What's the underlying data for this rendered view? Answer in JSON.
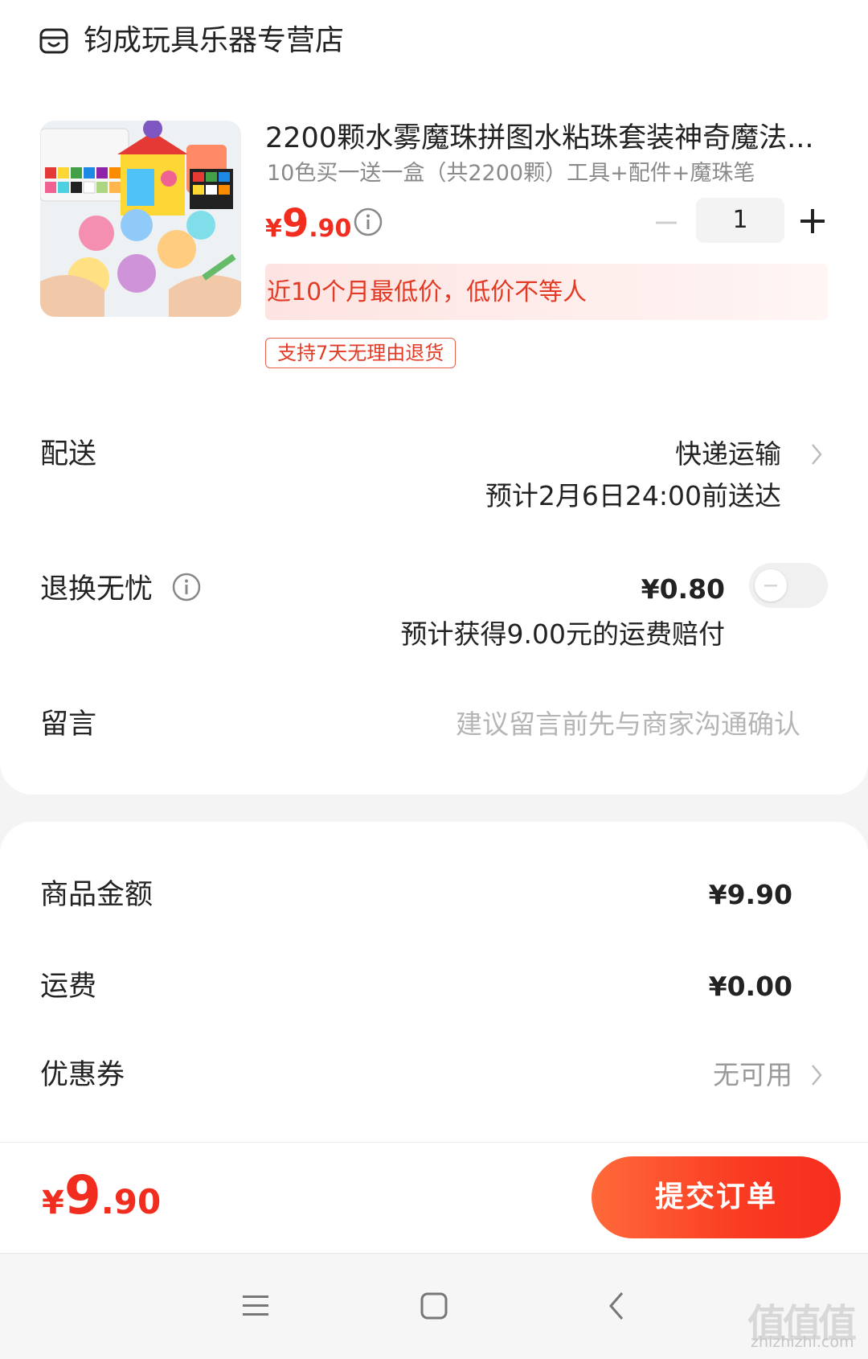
{
  "store": {
    "name": "钧成玩具乐器专营店",
    "icon": "store-icon"
  },
  "product": {
    "title": "2200颗水雾魔珠拼图水粘珠套装神奇魔法...",
    "spec": "10色买一送一盒（共2200颗）工具+配件+魔珠笔",
    "price_currency": "¥",
    "price_int": "9",
    "price_dec": ".90",
    "quantity": "1",
    "promo": "近10个月最低价，低价不等人",
    "return_badge": "支持7天无理由退货"
  },
  "delivery": {
    "label": "配送",
    "method": "快递运输",
    "estimate": "预计2月6日24:00前送达"
  },
  "return_insurance": {
    "label": "退换无忧",
    "price": "¥0.80",
    "note": "预计获得9.00元的运费赔付",
    "enabled": false
  },
  "message": {
    "label": "留言",
    "placeholder": "建议留言前先与商家沟通确认"
  },
  "summary": {
    "goods_label": "商品金额",
    "goods_value": "¥9.90",
    "shipping_label": "运费",
    "shipping_value": "¥0.00",
    "coupon_label": "优惠券",
    "coupon_value": "无可用"
  },
  "footer": {
    "total_currency": "¥",
    "total_int": "9",
    "total_dec": ".90",
    "submit_label": "提交订单"
  },
  "watermark": {
    "text": "值值值",
    "url": "zhizhizhi.com"
  },
  "colors": {
    "accent": "#f02d1f",
    "button": "#f83c22"
  }
}
